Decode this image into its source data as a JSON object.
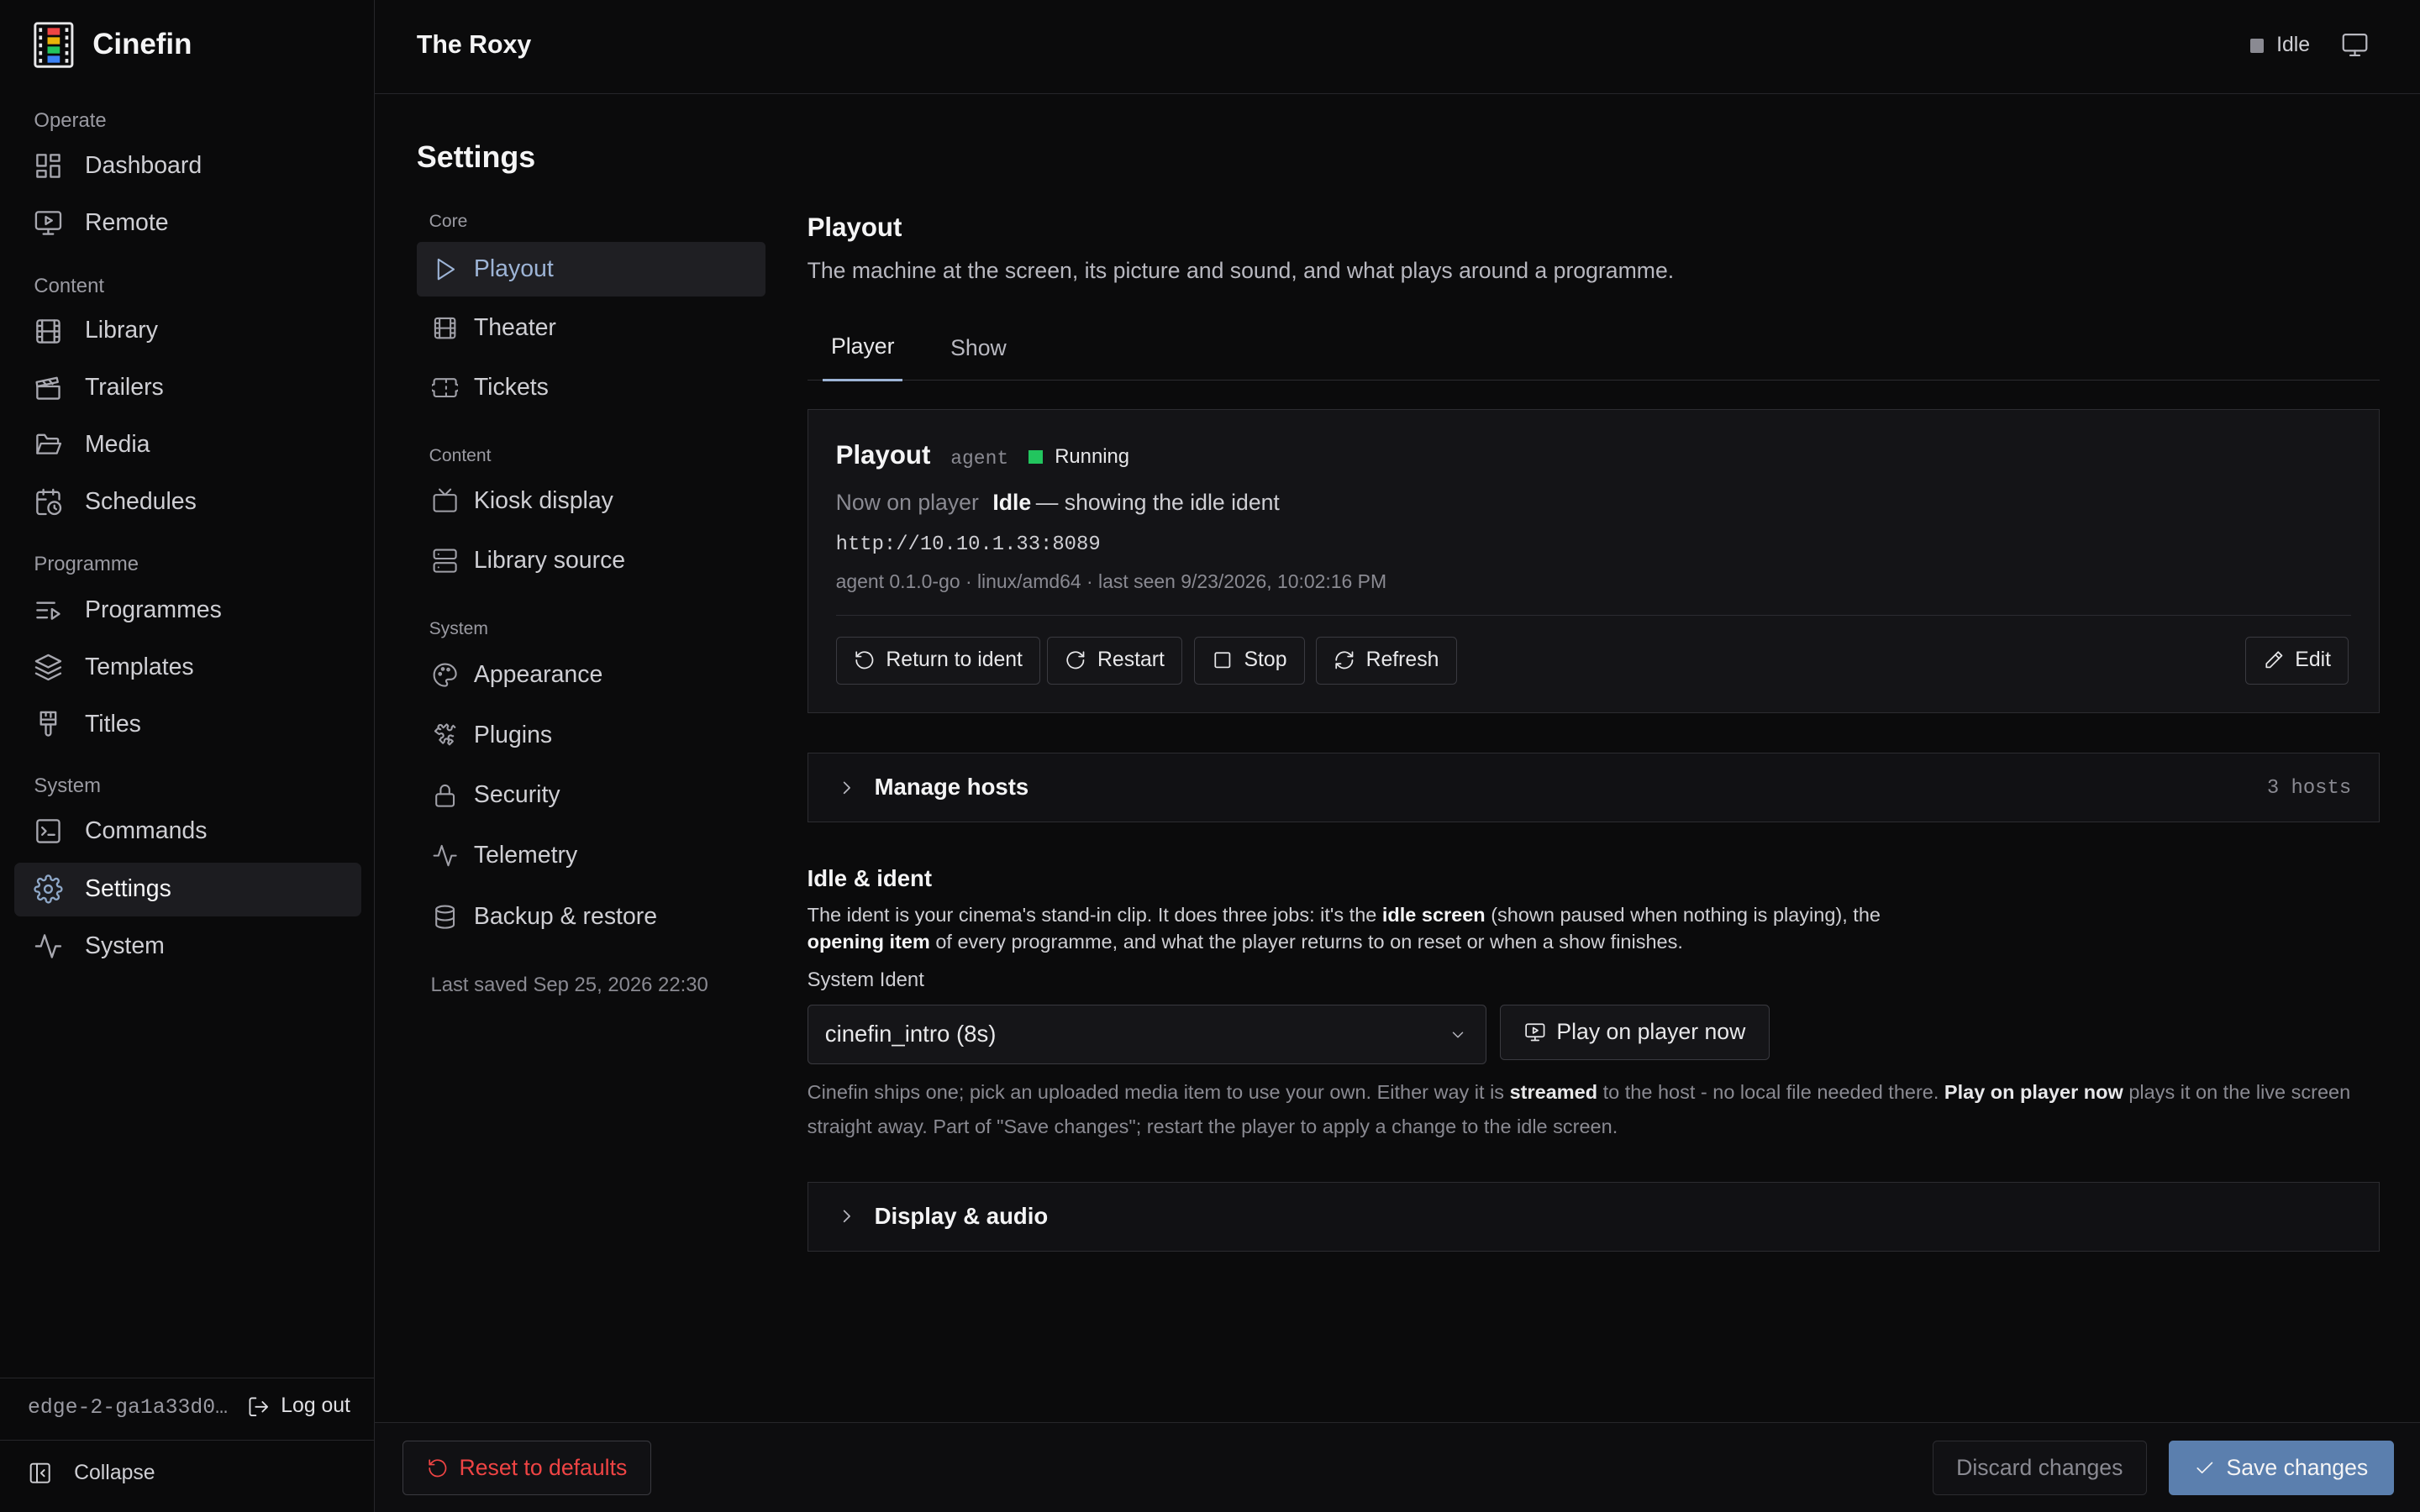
{
  "app": {
    "name": "Cinefin",
    "venue": "The Roxy",
    "status": "Idle"
  },
  "sidebar": {
    "groups": [
      {
        "label": "Operate",
        "items": [
          {
            "label": "Dashboard"
          },
          {
            "label": "Remote"
          }
        ]
      },
      {
        "label": "Content",
        "items": [
          {
            "label": "Library"
          },
          {
            "label": "Trailers"
          },
          {
            "label": "Media"
          },
          {
            "label": "Schedules"
          }
        ]
      },
      {
        "label": "Programme",
        "items": [
          {
            "label": "Programmes"
          },
          {
            "label": "Templates"
          },
          {
            "label": "Titles"
          }
        ]
      },
      {
        "label": "System",
        "items": [
          {
            "label": "Commands"
          },
          {
            "label": "Settings"
          },
          {
            "label": "System"
          }
        ]
      }
    ],
    "host": "edge-2-ga1a33d0…",
    "logout": "Log out",
    "collapse": "Collapse"
  },
  "settings": {
    "title": "Settings",
    "groups": [
      {
        "label": "Core",
        "items": [
          {
            "label": "Playout"
          },
          {
            "label": "Theater"
          },
          {
            "label": "Tickets"
          }
        ]
      },
      {
        "label": "Content",
        "items": [
          {
            "label": "Kiosk display"
          },
          {
            "label": "Library source"
          }
        ]
      },
      {
        "label": "System",
        "items": [
          {
            "label": "Appearance"
          },
          {
            "label": "Plugins"
          },
          {
            "label": "Security"
          },
          {
            "label": "Telemetry"
          },
          {
            "label": "Backup & restore"
          }
        ]
      }
    ],
    "last_saved": "Last saved Sep 25, 2026 22:30"
  },
  "playout": {
    "title": "Playout",
    "description": "The machine at the screen, its picture and sound, and what plays around a programme.",
    "tabs": [
      {
        "label": "Player",
        "active": true
      },
      {
        "label": "Show",
        "active": false
      }
    ],
    "agent_card": {
      "title": "Playout",
      "tag": "agent",
      "status": "Running",
      "status_color": "#22c55e",
      "now_label": "Now on player",
      "now_value": "Idle",
      "now_detail": "— showing the idle ident",
      "url": "http://10.10.1.33:8089",
      "meta": "agent 0.1.0-go · linux/amd64 · last seen 9/23/2026, 10:02:16 PM",
      "buttons": {
        "return": "Return to ident",
        "restart": "Restart",
        "stop": "Stop",
        "refresh": "Refresh",
        "edit": "Edit"
      }
    },
    "manage_hosts": {
      "label": "Manage hosts",
      "count": "3 hosts"
    },
    "idle": {
      "heading": "Idle & ident",
      "desc_1": "The ident is your cinema's stand-in clip. It does three jobs: it's the",
      "desc_b1": "idle screen",
      "desc_2": "(shown paused when nothing is playing), the",
      "desc_b2": "opening item",
      "desc_3": "of every programme, and what the player returns to on reset or when a show finishes.",
      "field_label": "System Ident",
      "select_value": "cinefin_intro (8s)",
      "play_button": "Play on player now",
      "help_1": "Cinefin ships one; pick an uploaded media item to use your own. Either way it is",
      "help_b1": "streamed",
      "help_2": "to the host - no local file needed there.",
      "help_b2": "Play on player now",
      "help_3": "plays it on the live screen straight away. Part of \"Save changes\"; restart the player to apply a change to the idle screen."
    },
    "display_audio": {
      "label": "Display & audio"
    }
  },
  "footer": {
    "reset": "Reset to defaults",
    "discard": "Discard changes",
    "save": "Save changes",
    "danger_color": "#ef4444",
    "accent_color": "#5b7fae"
  }
}
